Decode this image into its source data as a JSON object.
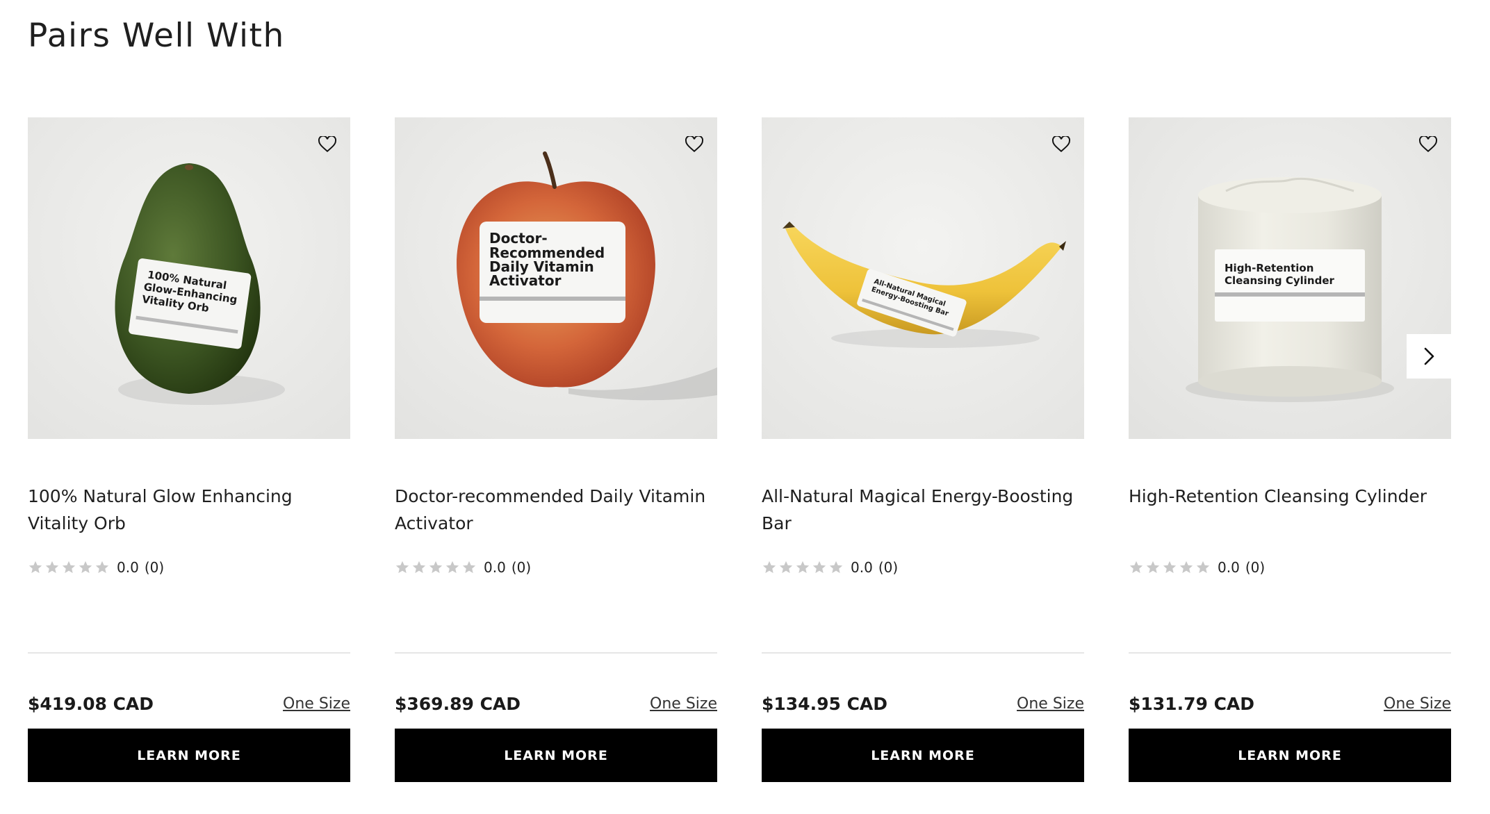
{
  "section": {
    "title": "Pairs Well With"
  },
  "products": [
    {
      "name": "100% Natural Glow Enhancing Vitality Orb",
      "label_lines": [
        "100% Natural",
        "Glow-Enhancing",
        "Vitality Orb"
      ],
      "rating_score": "0.0",
      "rating_count": "(0)",
      "rating_stars": 0,
      "price": "$419.08 CAD",
      "size": "One Size",
      "cta": "LEARN MORE",
      "image_icon": "avocado-icon"
    },
    {
      "name": "Doctor-recommended Daily Vitamin Activator",
      "label_lines": [
        "Doctor-",
        "Recommended",
        "Daily Vitamin",
        "Activator"
      ],
      "rating_score": "0.0",
      "rating_count": "(0)",
      "rating_stars": 0,
      "price": "$369.89 CAD",
      "size": "One Size",
      "cta": "LEARN MORE",
      "image_icon": "apple-icon"
    },
    {
      "name": "All-Natural Magical Energy-Boosting Bar",
      "label_lines": [
        "All-Natural Magical",
        "Energy-Boosting Bar"
      ],
      "rating_score": "0.0",
      "rating_count": "(0)",
      "rating_stars": 0,
      "price": "$134.95 CAD",
      "size": "One Size",
      "cta": "LEARN MORE",
      "image_icon": "banana-icon"
    },
    {
      "name": "High-Retention Cleansing Cylinder",
      "label_lines": [
        "High-Retention",
        "Cleansing Cylinder"
      ],
      "rating_score": "0.0",
      "rating_count": "(0)",
      "rating_stars": 0,
      "price": "$131.79 CAD",
      "size": "One Size",
      "cta": "LEARN MORE",
      "image_icon": "toilet-paper-icon"
    }
  ],
  "icons": {
    "wishlist": "heart-outline-icon",
    "carousel_next": "chevron-right-icon",
    "star": "star-icon"
  },
  "colors": {
    "button_bg": "#000000",
    "button_text": "#ffffff",
    "star_empty": "#c8c8c8",
    "divider": "#e6e6e6"
  }
}
